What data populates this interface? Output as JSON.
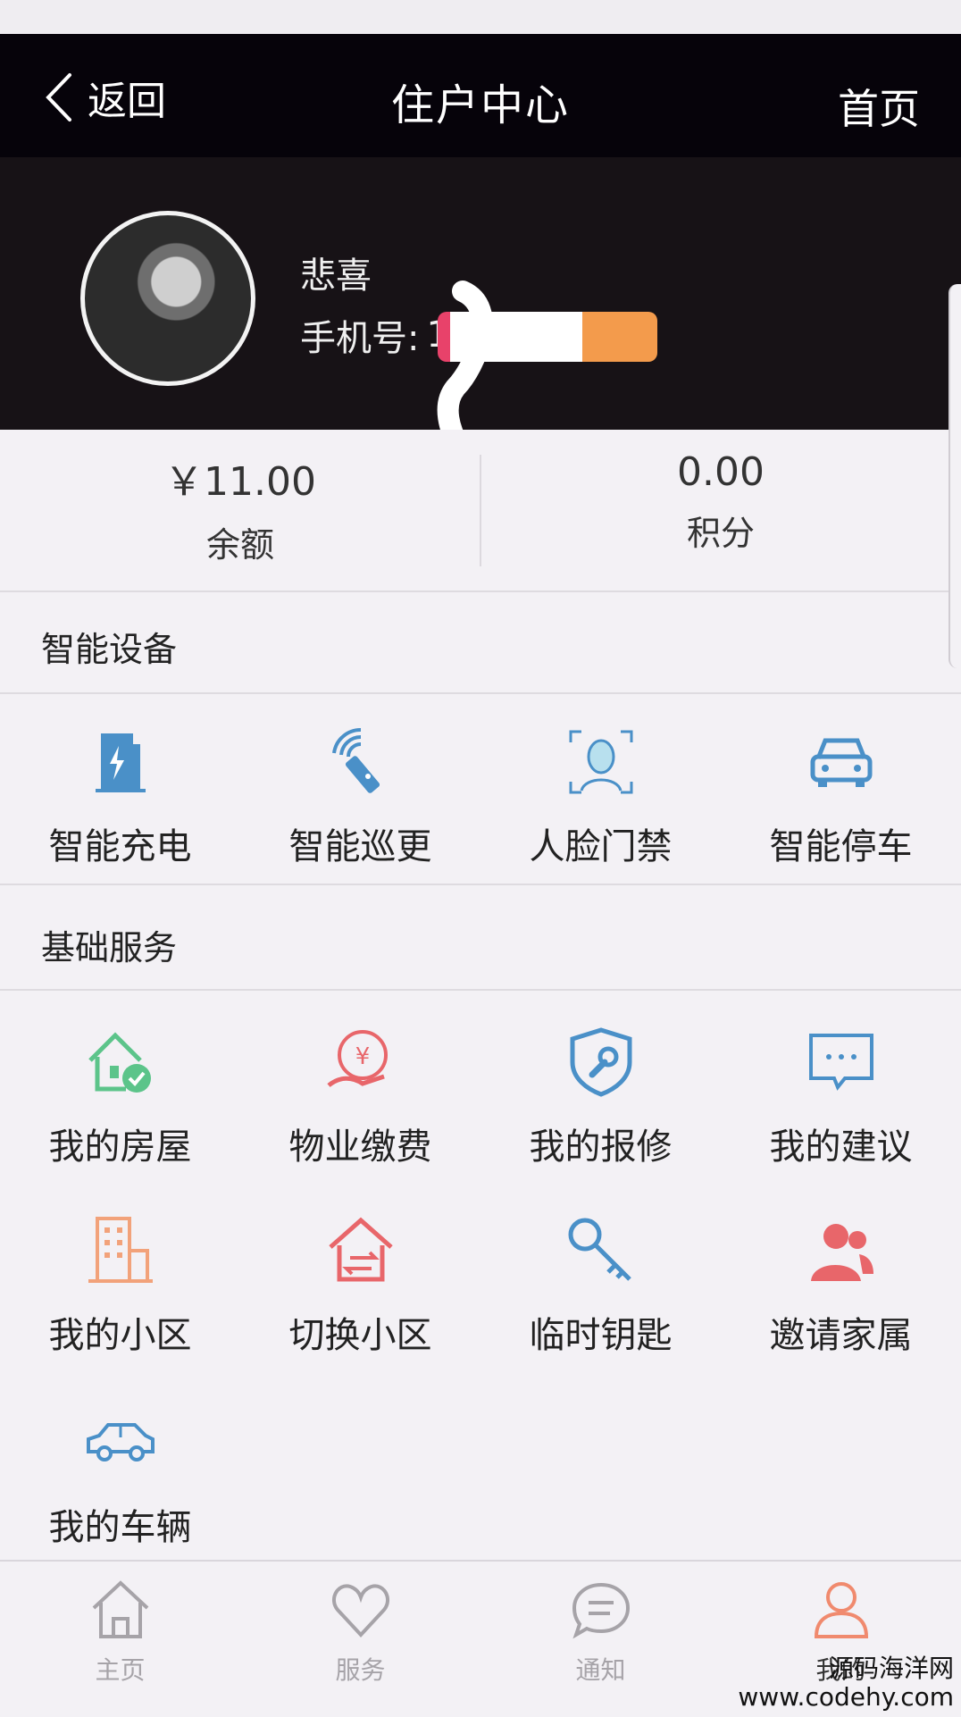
{
  "header": {
    "back_label": "返回",
    "title": "住户中心",
    "home_label": "首页"
  },
  "profile": {
    "name": "悲喜",
    "phone_label": "手机号:",
    "phone_value": "1"
  },
  "stats": [
    {
      "value": "￥11.00",
      "label": "余额"
    },
    {
      "value": "0.00",
      "label": "积分"
    }
  ],
  "sections": {
    "smart_devices": {
      "title": "智能设备",
      "items": [
        {
          "label": "智能充电",
          "icon": "charging-station-icon"
        },
        {
          "label": "智能巡更",
          "icon": "patrol-remote-icon"
        },
        {
          "label": "人脸门禁",
          "icon": "face-scan-icon"
        },
        {
          "label": "智能停车",
          "icon": "parking-car-icon"
        }
      ]
    },
    "basic_services": {
      "title": "基础服务",
      "items": [
        {
          "label": "我的房屋",
          "icon": "house-check-icon"
        },
        {
          "label": "物业缴费",
          "icon": "payment-hand-icon"
        },
        {
          "label": "我的报修",
          "icon": "repair-shield-icon"
        },
        {
          "label": "我的建议",
          "icon": "chat-bubble-icon"
        },
        {
          "label": "我的小区",
          "icon": "building-icon"
        },
        {
          "label": "切换小区",
          "icon": "switch-house-icon"
        },
        {
          "label": "临时钥匙",
          "icon": "key-icon"
        },
        {
          "label": "邀请家属",
          "icon": "family-icon"
        },
        {
          "label": "我的车辆",
          "icon": "car-icon"
        }
      ]
    }
  },
  "tabbar": [
    {
      "label": "主页",
      "icon": "home-icon"
    },
    {
      "label": "服务",
      "icon": "heart-icon"
    },
    {
      "label": "通知",
      "icon": "message-icon"
    },
    {
      "label": "我的",
      "icon": "user-icon"
    }
  ],
  "active_tab": "我的",
  "watermark": {
    "line1": "源码海洋网",
    "line2": "www.codehy.com"
  },
  "colors": {
    "header_bg": "#06030a",
    "profile_bg": "#171216",
    "page_bg": "#f3f1f5",
    "blue_icon": "#4a90c8",
    "green_icon": "#5cc48a",
    "red_icon": "#e8666a",
    "orange_icon": "#f2a27a",
    "active_tab": "#f08a6e",
    "inactive_tab": "#a6a3a8"
  }
}
